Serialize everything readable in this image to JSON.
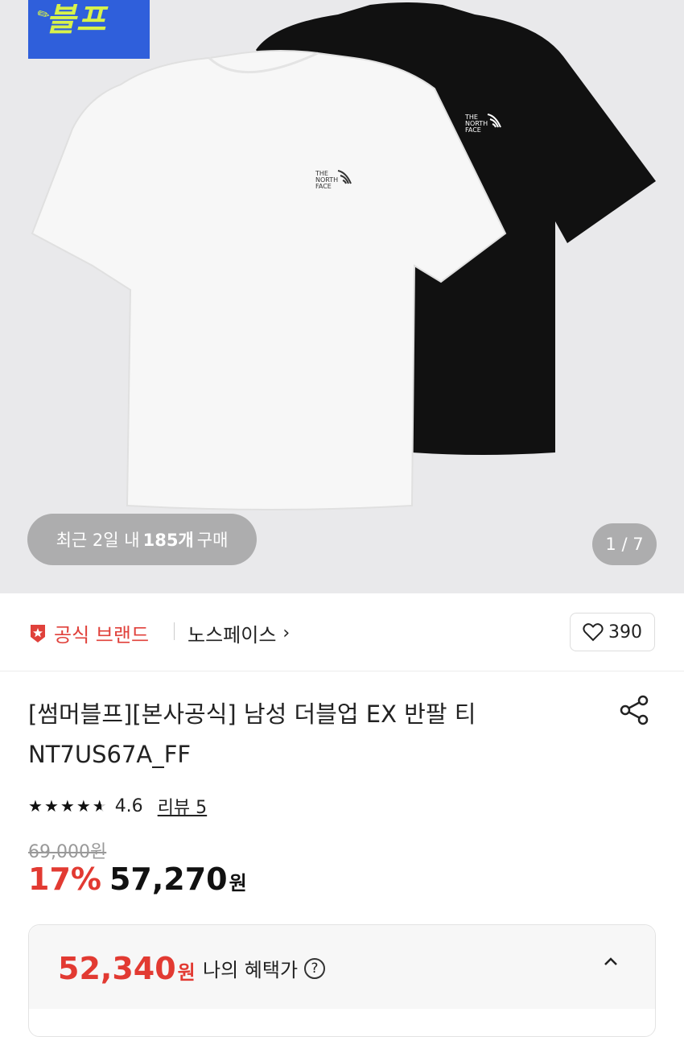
{
  "hero": {
    "promo_text": "블프",
    "recent_prefix": "최근 2일 내",
    "recent_count": "185개",
    "recent_suffix": "구매",
    "image_counter": "1 / 7",
    "logo_text": "THE NORTH FACE"
  },
  "brand": {
    "official_label": "공식 브랜드",
    "brand_name": "노스페이스",
    "chevron": "›",
    "like_count": "390"
  },
  "product": {
    "title": "[썸머블프][본사공식] 남성 더블업 EX 반팔 티 NT7US67A_FF",
    "rating": "4.6",
    "review_label": "리뷰 5",
    "original_price": "69,000원",
    "discount": "17%",
    "price": "57,270",
    "currency": "원"
  },
  "benefit": {
    "price": "52,340",
    "currency": "원",
    "label": "나의 혜택가",
    "help": "?",
    "collapse": "^"
  },
  "colors": {
    "accent_red": "#e23a32",
    "promo_blue": "#2f5fdb",
    "promo_yellow": "#d8f24a"
  }
}
